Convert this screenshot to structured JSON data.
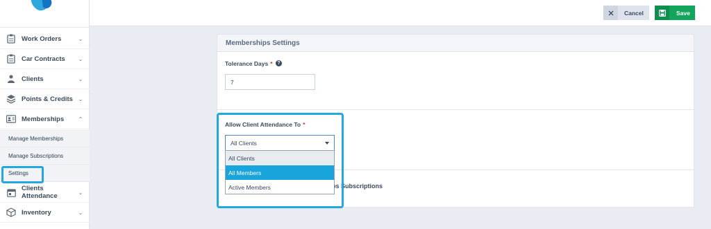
{
  "sidebar": {
    "items": [
      {
        "label": "Work Orders",
        "icon": "clipboard-icon"
      },
      {
        "label": "Car Contracts",
        "icon": "clipboard-icon"
      },
      {
        "label": "Clients",
        "icon": "users-icon"
      },
      {
        "label": "Points & Credits",
        "icon": "layers-icon"
      },
      {
        "label": "Memberships",
        "icon": "id-card-icon"
      },
      {
        "label": "Clients Attendance",
        "icon": "calendar-icon"
      },
      {
        "label": "Inventory",
        "icon": "box-icon"
      }
    ],
    "subitems": [
      {
        "label": "Manage Memberships"
      },
      {
        "label": "Manage Subscriptions"
      },
      {
        "label": "Settings"
      }
    ]
  },
  "toolbar": {
    "cancel_label": "Cancel",
    "save_label": "Save"
  },
  "panel": {
    "title": "Memberships Settings",
    "tolerance_label": "Tolerance Days",
    "tolerance_value": "7",
    "attendance_label": "Allow Client Attendance To",
    "required_mark": "*",
    "select_value": "All Clients",
    "options": [
      "All Clients",
      "All Members",
      "Active Members"
    ],
    "partial_label": "hips Subscriptions"
  },
  "colors": {
    "highlight": "#23a7de",
    "save": "#13a55c",
    "option_hover": "#1aa4dc"
  }
}
